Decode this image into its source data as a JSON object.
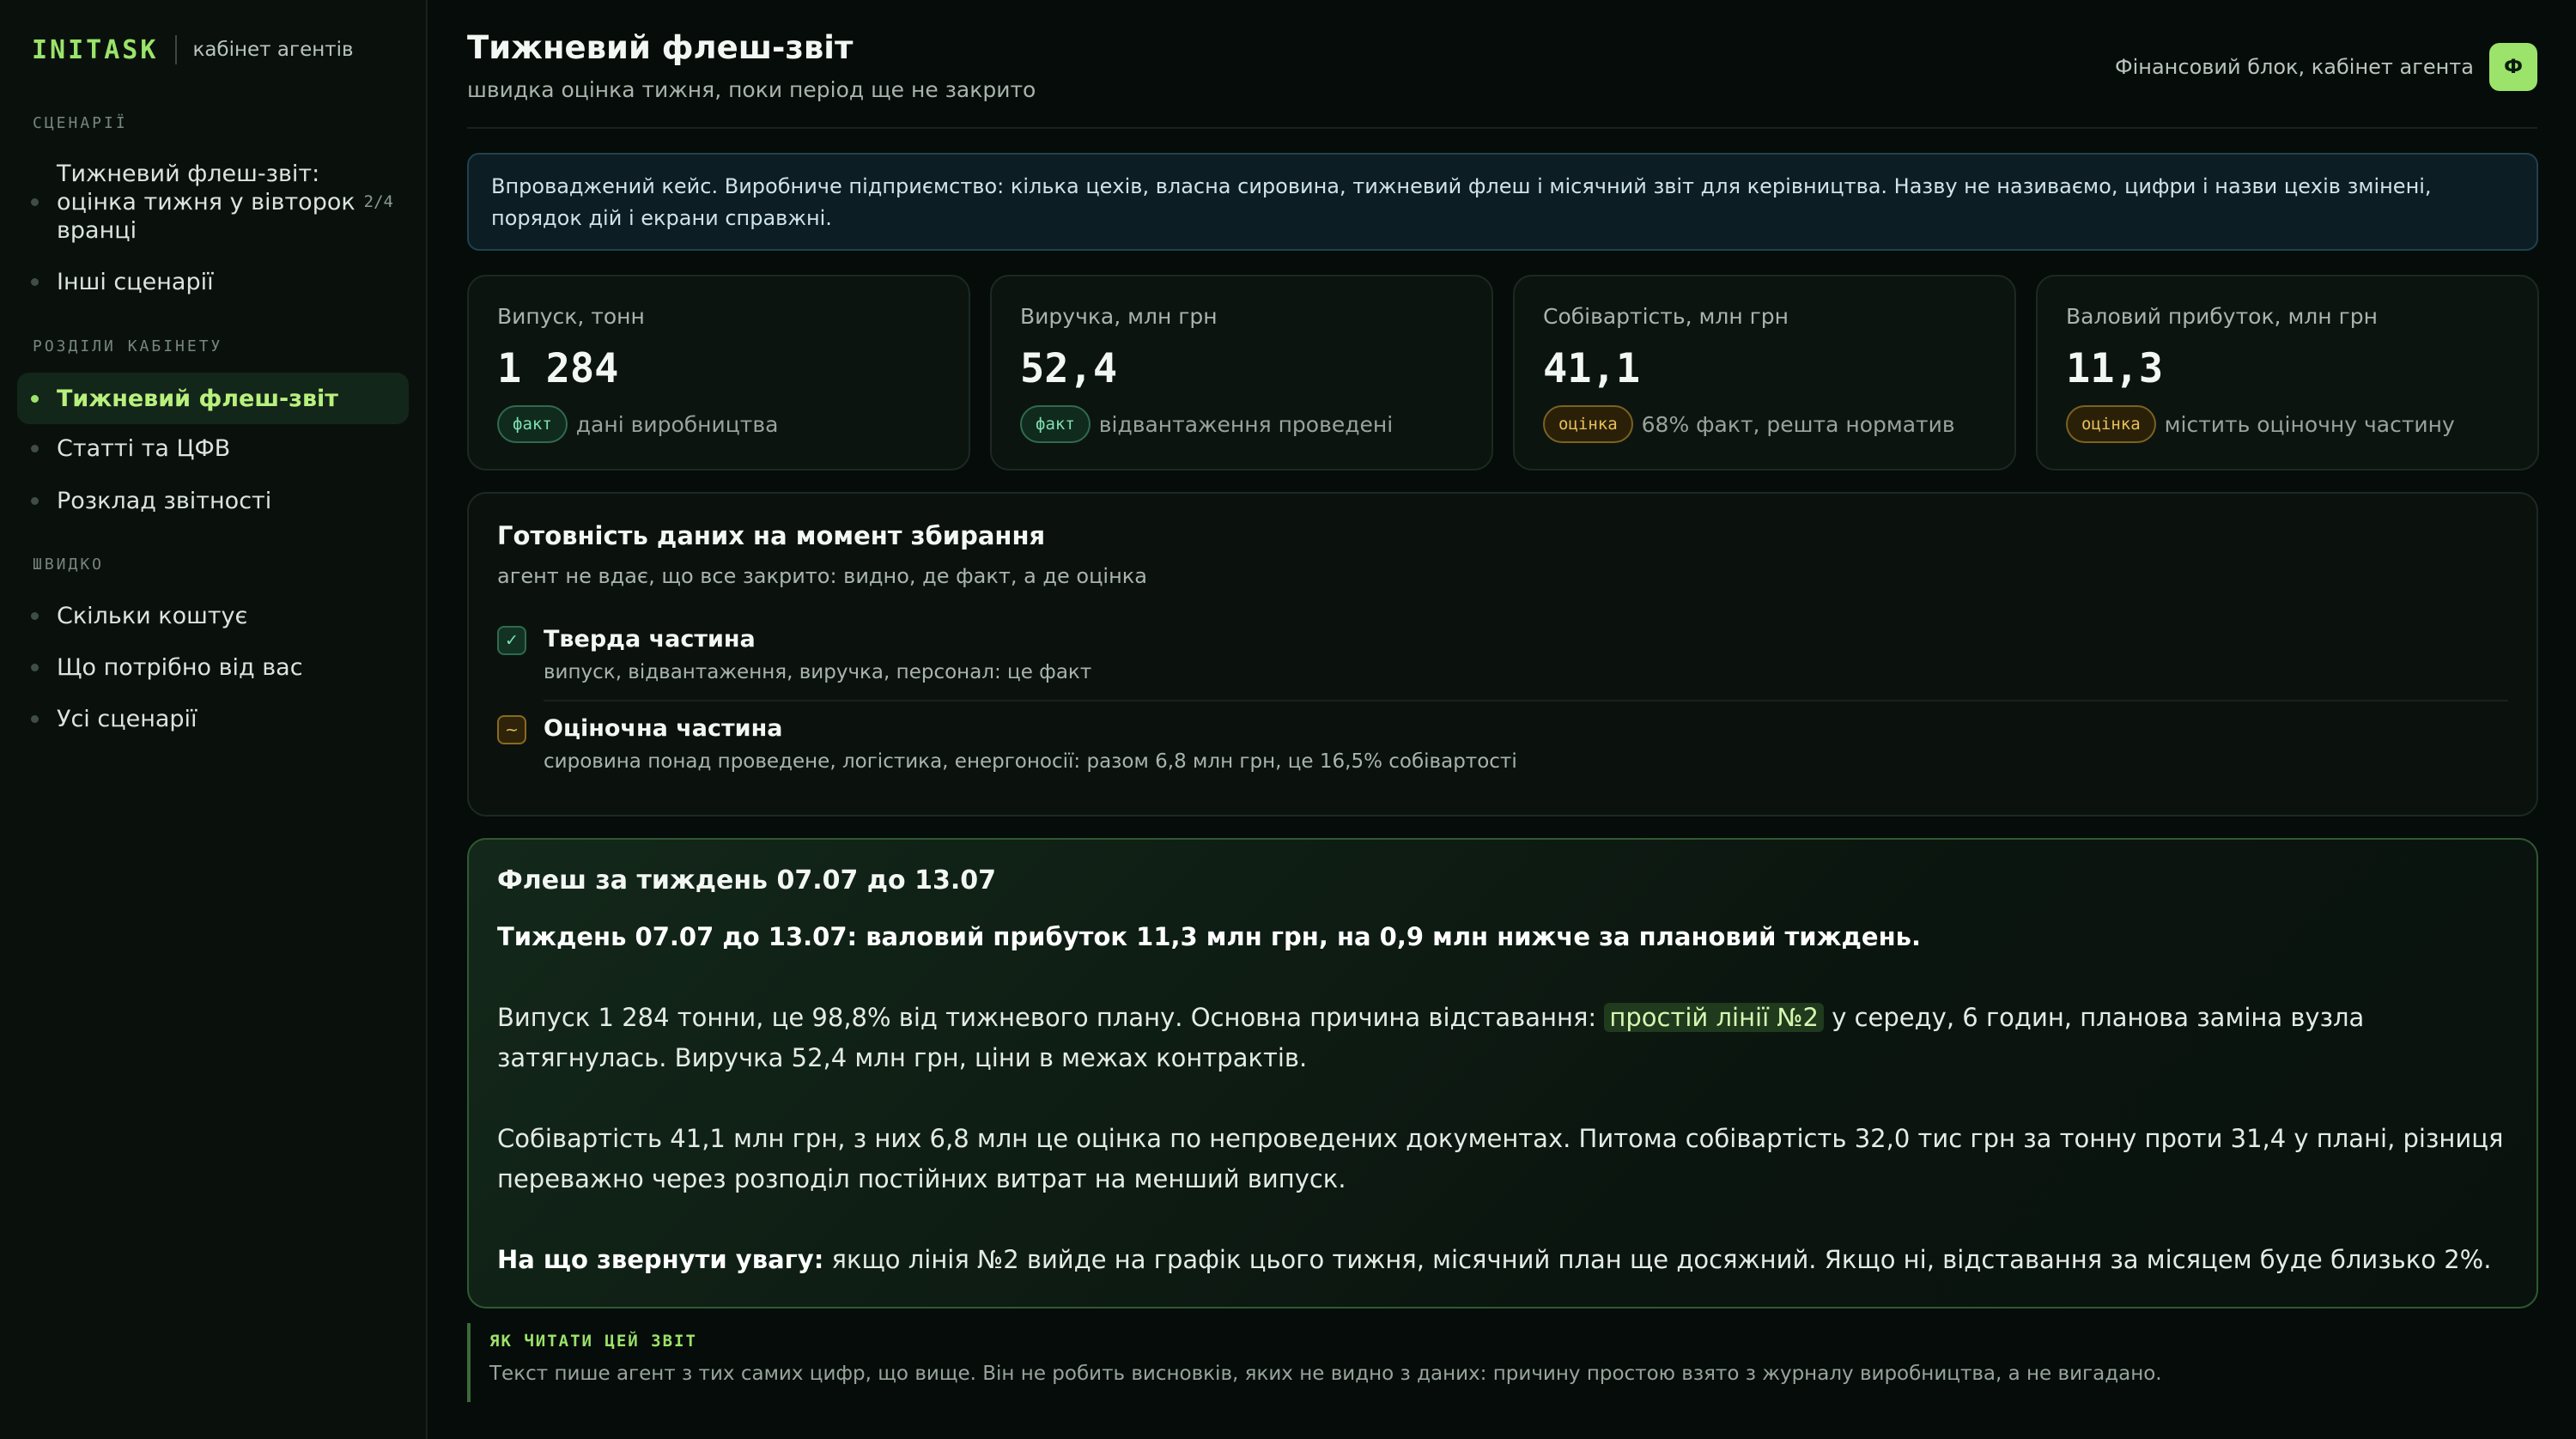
{
  "brand": {
    "name": "INITASK",
    "subtitle": "кабінет агентів"
  },
  "sidebar": {
    "sections": [
      {
        "title": "СЦЕНАРІЇ"
      },
      {
        "title": "РОЗДІЛИ КАБІНЕТУ"
      },
      {
        "title": "ШВИДКО"
      }
    ],
    "scenarios": [
      {
        "label": "Тижневий флеш-звіт: оцінка тижня у вівторок вранці",
        "count": "2/4"
      },
      {
        "label": "Інші сценарії"
      }
    ],
    "cabinet": [
      {
        "label": "Тижневий флеш-звіт",
        "active": true
      },
      {
        "label": "Статті та ЦФВ"
      },
      {
        "label": "Розклад звітності"
      }
    ],
    "quick": [
      {
        "label": "Скільки коштує"
      },
      {
        "label": "Що потрібно від вас"
      },
      {
        "label": "Усі сценарії"
      }
    ]
  },
  "header": {
    "title": "Тижневий флеш-звіт",
    "subtitle": "швидка оцінка тижня, поки період ще не закрито",
    "right_label": "Фінансовий блок, кабінет агента",
    "avatar": "Ф"
  },
  "banner": "Впроваджений кейс. Виробниче підприємство: кілька цехів, власна сировина, тижневий флеш і місячний звіт для керівництва. Назву не називаємо, цифри і назви цехів змінені, порядок дій і екрани справжні.",
  "metrics": [
    {
      "label": "Випуск, тонн",
      "value": "1 284",
      "badge": "факт",
      "note": "дані виробництва"
    },
    {
      "label": "Виручка, млн грн",
      "value": "52,4",
      "badge": "факт",
      "note": "відвантаження проведені"
    },
    {
      "label": "Собівартість, млн грн",
      "value": "41,1",
      "badge": "оцінка",
      "note": "68% факт, решта норматив"
    },
    {
      "label": "Валовий прибуток, млн грн",
      "value": "11,3",
      "badge": "оцінка",
      "note": "містить оціночну частину"
    }
  ],
  "readiness": {
    "title": "Готовність даних на момент збирання",
    "subtitle": "агент не вдає, що все закрито: видно, де факт, а де оцінка",
    "items": [
      {
        "icon": "✓",
        "head": "Тверда частина",
        "desc": "випуск, відвантаження, виручка, персонал: це факт"
      },
      {
        "icon": "~",
        "head": "Оціночна частина",
        "desc": "сировина понад проведене, логістика, енергоносії: разом 6,8 млн грн, це 16,5% собівартості"
      }
    ]
  },
  "flash": {
    "title": "Флеш за тиждень 07.07 до 13.07",
    "headline": "Тиждень 07.07 до 13.07: валовий прибуток 11,3 млн грн, на 0,9 млн нижче за плановий тиждень.",
    "p1_a": "Випуск 1 284 тонни, це 98,8% від тижневого плану. Основна причина відставання: ",
    "p1_hl": "простій лінії №2",
    "p1_b": " у середу, 6 годин, планова заміна вузла затягнулась. Виручка 52,4 млн грн, ціни в межах контрактів.",
    "p2": "Собівартість 41,1 млн грн, з них 6,8 млн це оцінка по непроведених документах. Питома собівартість 32,0 тис грн за тонну проти 31,4 у плані, різниця переважно через розподіл постійних витрат на менший випуск.",
    "p3_bold": "На що звернути увагу:",
    "p3_rest": " якщо лінія №2 вийде на графік цього тижня, місячний план ще досяжний. Якщо ні, відставання за місяцем буде близько 2%."
  },
  "note": {
    "label": "ЯК ЧИТАТИ ЦЕЙ ЗВІТ",
    "text": "Текст пише агент з тих самих цифр, що вище. Він не робить висновків, яких не видно з даних: причину простою взято з журналу виробництва, а не вигадано."
  }
}
